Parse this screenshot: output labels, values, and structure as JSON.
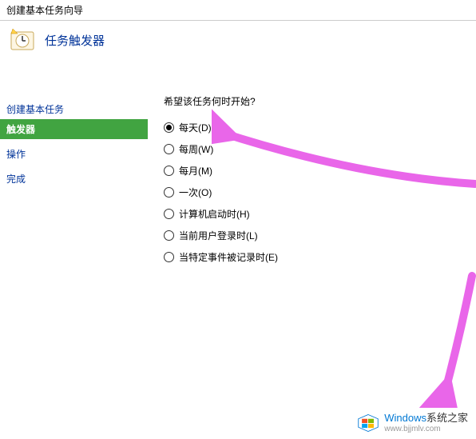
{
  "window": {
    "title": "创建基本任务向导"
  },
  "header": {
    "title": "任务触发器"
  },
  "sidebar": {
    "items": [
      {
        "label": "创建基本任务",
        "active": false
      },
      {
        "label": "触发器",
        "active": true
      },
      {
        "label": "操作",
        "active": false
      },
      {
        "label": "完成",
        "active": false
      }
    ]
  },
  "main": {
    "question": "希望该任务何时开始?",
    "options": [
      {
        "label": "每天(D)",
        "checked": true
      },
      {
        "label": "每周(W)",
        "checked": false
      },
      {
        "label": "每月(M)",
        "checked": false
      },
      {
        "label": "一次(O)",
        "checked": false
      },
      {
        "label": "计算机启动时(H)",
        "checked": false
      },
      {
        "label": "当前用户登录时(L)",
        "checked": false
      },
      {
        "label": "当特定事件被记录时(E)",
        "checked": false
      }
    ]
  },
  "watermark": {
    "brand_en": "Windows",
    "brand_cn": "系统之家",
    "url": "www.bjjmlv.com"
  },
  "colors": {
    "sidebar_active": "#41A441",
    "link_blue": "#003399",
    "arrow": "#E966E9"
  }
}
